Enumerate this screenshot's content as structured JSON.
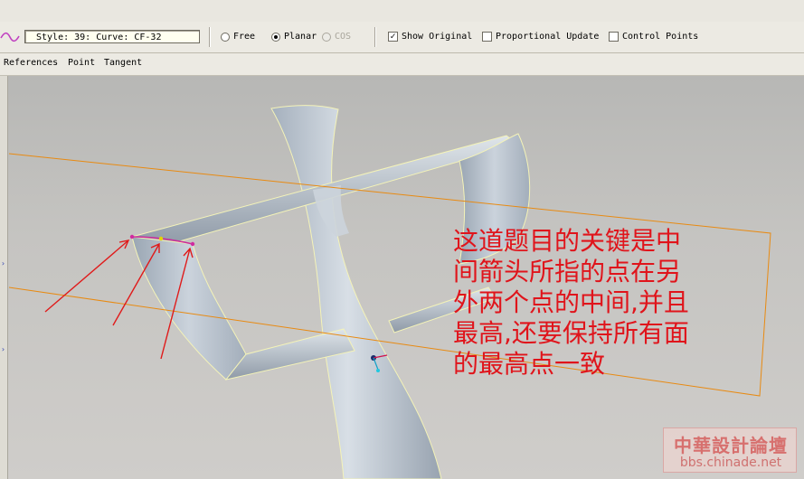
{
  "toolbar": {
    "style_value": "Style: 39: Curve:   CF-32",
    "radio_free": "Free",
    "radio_planar": "Planar",
    "radio_cos": "COS",
    "selected_mode": "Planar",
    "show_original_label": "Show Original",
    "show_original_checked": true,
    "proportional_update_label": "Proportional Update",
    "proportional_update_checked": false,
    "control_points_label": "Control Points",
    "control_points_checked": false
  },
  "menu": {
    "items": [
      "References",
      "Point",
      "Tangent"
    ]
  },
  "annotation": {
    "lines": [
      "这道题目的关键是中",
      "间箭头所指的点在另",
      "外两个点的中间,并且",
      "最高,还要保持所有面",
      "的最高点一致"
    ],
    "color": "#e0141b"
  },
  "watermark": {
    "title": "中華設計論壇",
    "url": "bbs.chinade.net"
  },
  "colors": {
    "surface": "#c4cdd7",
    "edge_highlight": "#f4f3b8",
    "datum_plane": "#e88a12",
    "arrow": "#e01a1a",
    "curve_icon": "#c040c0"
  },
  "icons": [
    "curve-icon",
    "arrow-right-icon",
    "check-icon",
    "datum-csys-icon"
  ]
}
